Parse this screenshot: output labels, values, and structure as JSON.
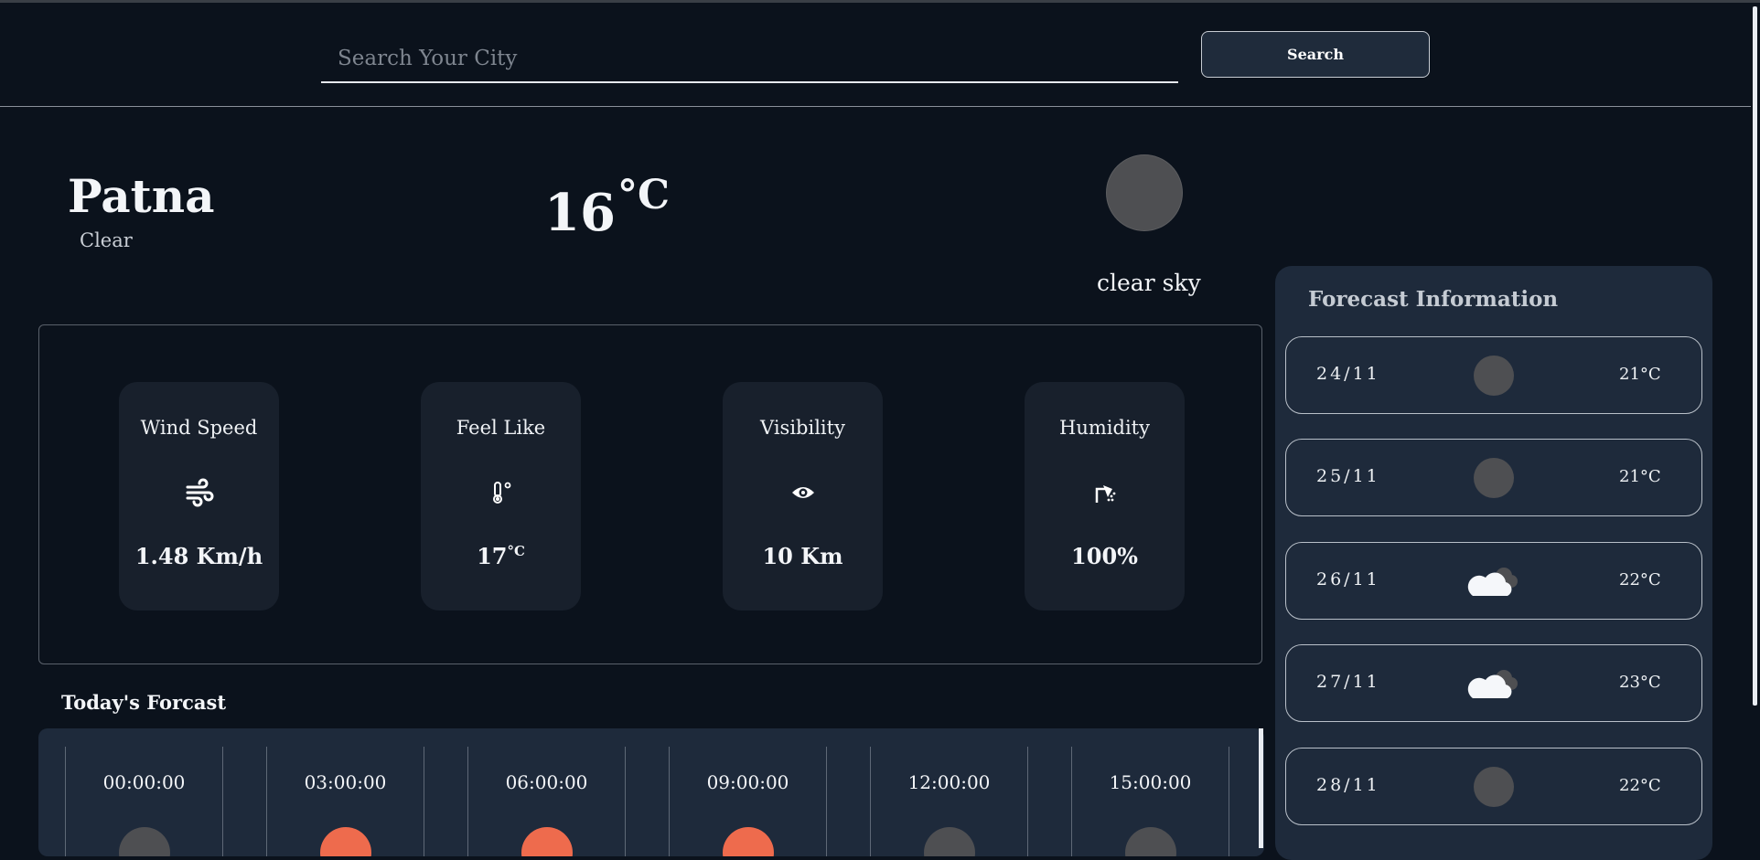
{
  "search": {
    "placeholder": "Search Your City",
    "value": "",
    "button_label": "Search"
  },
  "current": {
    "city": "Patna",
    "condition": "Clear",
    "temperature": "16",
    "unit": "°C",
    "description": "clear sky",
    "icon": "moon-icon"
  },
  "highlights": [
    {
      "label": "Wind Speed",
      "icon": "wind-icon",
      "value": "1.48 Km/h"
    },
    {
      "label": "Feel Like",
      "icon": "thermometer-icon",
      "value": "17",
      "unit": "°C"
    },
    {
      "label": "Visibility",
      "icon": "eye-icon",
      "value": "10 Km"
    },
    {
      "label": "Humidity",
      "icon": "shower-icon",
      "value": "100%"
    }
  ],
  "today": {
    "title": "Today's Forcast",
    "hours": [
      {
        "time": "00:00:00",
        "icon": "moon-icon",
        "color": "#4e4f52"
      },
      {
        "time": "03:00:00",
        "icon": "sun-icon",
        "color": "#ee6b4d"
      },
      {
        "time": "06:00:00",
        "icon": "sun-icon",
        "color": "#ee6b4d"
      },
      {
        "time": "09:00:00",
        "icon": "sun-icon",
        "color": "#ee6b4d"
      },
      {
        "time": "12:00:00",
        "icon": "moon-icon",
        "color": "#4e4f52"
      },
      {
        "time": "15:00:00",
        "icon": "moon-icon",
        "color": "#4e4f52"
      }
    ]
  },
  "forecast": {
    "title": "Forecast Information",
    "days": [
      {
        "date": "24/11",
        "icon": "moon-icon",
        "temp": "21°C"
      },
      {
        "date": "25/11",
        "icon": "moon-icon",
        "temp": "21°C"
      },
      {
        "date": "26/11",
        "icon": "cloud-icon",
        "temp": "22°C"
      },
      {
        "date": "27/11",
        "icon": "cloud-icon",
        "temp": "23°C"
      },
      {
        "date": "28/11",
        "icon": "moon-icon",
        "temp": "22°C"
      }
    ]
  },
  "colors": {
    "background": "#0b121c",
    "panel": "#1e2a3b",
    "card": "#18202c",
    "sun": "#ee6b4d",
    "moon": "#4e4f52"
  }
}
